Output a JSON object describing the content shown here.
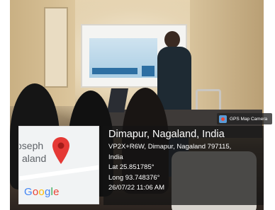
{
  "badge": {
    "label": "GPS Map Camera",
    "icon": "map-pin-icon"
  },
  "map": {
    "place_text_1": "oseph",
    "place_text_2": "aland",
    "pin_icon": "location-pin-icon",
    "pin_color": "#e53935",
    "brand": {
      "g1": "G",
      "g2": "o",
      "g3": "o",
      "g4": "g",
      "g5": "l",
      "g6": "e"
    }
  },
  "location": {
    "title": "Dimapur, Nagaland, India",
    "address_line_1": "VP2X+R6W, Dimapur, Nagaland 797115,",
    "address_line_2": "India",
    "lat": "Lat 25.851785°",
    "long": "Long 93.748376°",
    "datetime": "26/07/22 11:06 AM"
  }
}
